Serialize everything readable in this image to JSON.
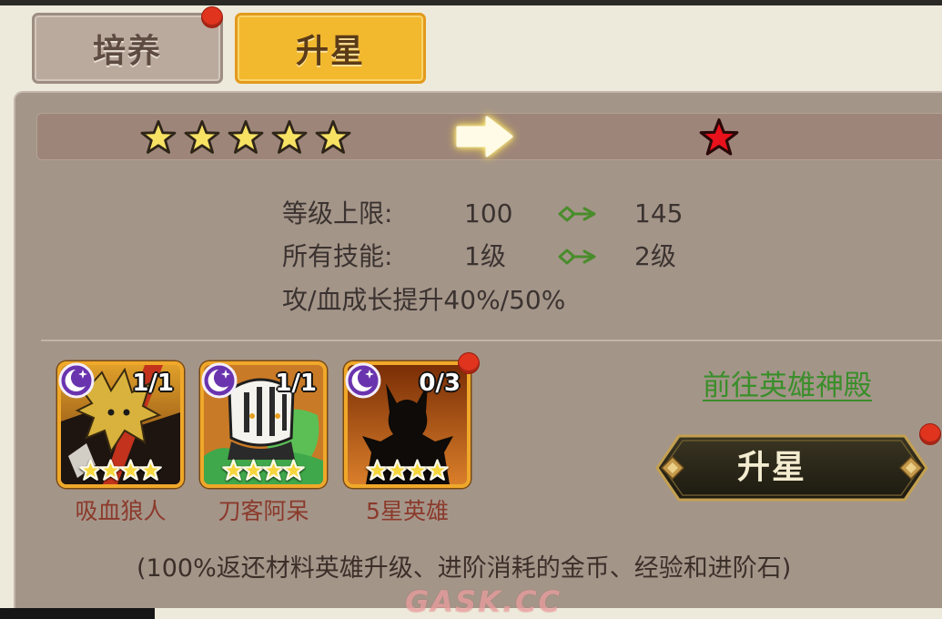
{
  "tabs": [
    {
      "label": "培养",
      "active": false,
      "badge": true
    },
    {
      "label": "升星",
      "active": true,
      "badge": false
    }
  ],
  "star_bar": {
    "current_stars": 5,
    "next_stars": 1,
    "arrow_icon": "arrow-right-icon"
  },
  "stats": [
    {
      "label": "等级上限:",
      "from": "100",
      "to": "145"
    },
    {
      "label": "所有技能:",
      "from": "1级",
      "to": "2级"
    }
  ],
  "growth_text": "攻/血成长提升40%/50%",
  "materials": [
    {
      "name": "吸血狼人",
      "count": "1/1",
      "stars": 4,
      "element_icon": "moon-icon",
      "portrait_icon": "werewolf-portrait",
      "badge": false
    },
    {
      "name": "刀客阿呆",
      "count": "1/1",
      "stars": 4,
      "element_icon": "moon-icon",
      "portrait_icon": "swordsman-portrait",
      "badge": false
    },
    {
      "name": "5星英雄",
      "count": "0/3",
      "stars": 4,
      "element_icon": "moon-icon",
      "portrait_icon": "hero-silhouette",
      "badge": true
    }
  ],
  "temple_link": "前往英雄神殿",
  "upgrade_button": {
    "label": "升星",
    "badge": true
  },
  "footnote": "(100%返还材料英雄升级、进阶消耗的金币、经验和进阶石)",
  "watermark": "GASK.CC",
  "colors": {
    "active_tab": "#f2b82e",
    "star": "#f8e264",
    "upgrade_star": "#e8121c",
    "card_star": "#f6d63e",
    "link": "#3a8e2a",
    "badge": "#e0341e",
    "element_badge": "#6a34ae"
  }
}
